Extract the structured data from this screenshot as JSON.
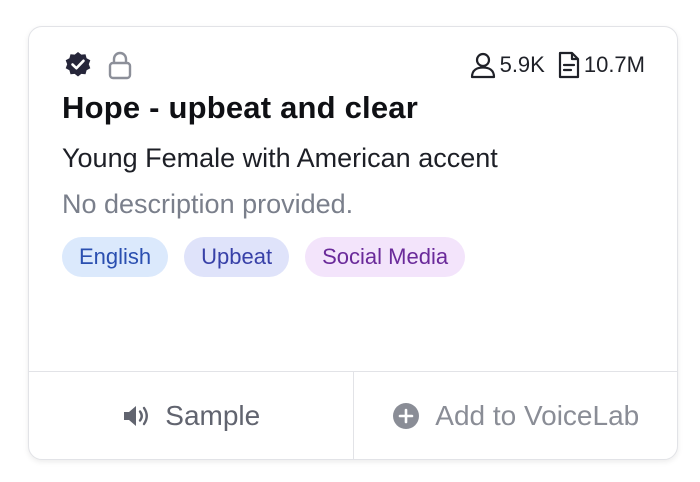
{
  "voice_card": {
    "title": "Hope - upbeat and clear",
    "subtitle": "Young Female with American accent",
    "description": "No description provided.",
    "stats": {
      "users": "5.9K",
      "characters": "10.7M"
    },
    "tags": [
      "English",
      "Upbeat",
      "Social Media"
    ],
    "actions": {
      "sample": "Sample",
      "add": "Add to VoiceLab"
    },
    "icons": {
      "verified": "verified-badge-icon",
      "lock": "lock-icon",
      "users": "user-icon",
      "characters": "document-icon",
      "sample": "speaker-icon",
      "add": "plus-circle-icon"
    },
    "colors": {
      "tag_language": "#dbe9fc",
      "tag_mood": "#dfe3fa",
      "tag_use": "#f3e4fb"
    }
  }
}
